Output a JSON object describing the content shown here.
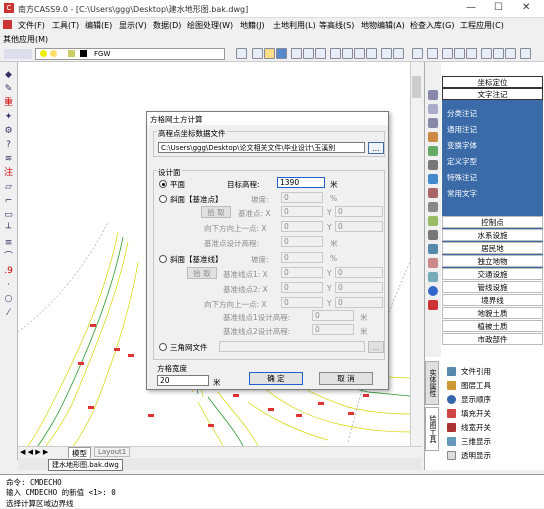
{
  "window": {
    "title": "南方CASS9.0 - [C:\\Users\\ggg\\Desktop\\建水地形图.bak.dwg]"
  },
  "menu": [
    "文件(F)",
    "工具(T)",
    "编辑(E)",
    "显示(V)",
    "数据(D)",
    "绘图处理(W)",
    "地籍(J)",
    "土地利用(L)",
    "等高线(S)",
    "地物编辑(A)",
    "检查入库(G)",
    "工程应用(C)"
  ],
  "menu2": "其他应用(M)",
  "layer": "FGW",
  "right_panel": {
    "top": [
      "坐标定位",
      "文字注记"
    ],
    "highlighted": [
      "分类注记",
      "通用注记",
      "变换字体",
      "定义字型",
      "特殊注记",
      "常用文字"
    ],
    "items": [
      "控制点",
      "水系设施",
      "居民地",
      "独立地物",
      "交通设施",
      "管线设施",
      "境界线",
      "地貌土质",
      "植被土质",
      "市政部件"
    ]
  },
  "right_bottom": {
    "tabs": [
      "实体属性",
      "绘图工具"
    ],
    "items": [
      "文件引用",
      "图层工具",
      "显示顺序",
      "填充开关",
      "线宽开关",
      "三维显示",
      "透明显示"
    ]
  },
  "tabs": {
    "model": "模型",
    "layout": "Layout1",
    "file": "建水地形图.bak.dwg"
  },
  "command": [
    "命令: CMDECHO",
    "输入 CMDECHO 的新值 <1>: 0",
    "选择计算区域边界线"
  ],
  "dialog": {
    "title": "方格网土方计算",
    "group1": "高程点坐标数据文件",
    "file_path": "C:\\Users\\ggg\\Desktop\\论文相关文件\\毕业设计\\玉溪别",
    "browse": "...",
    "design_group": "设计面",
    "flat_label": "平面",
    "target_elev_label": "目标高程:",
    "target_elev": "1390",
    "unit_m": "米",
    "slope1_label": "斜面【基准点】",
    "slope_label": "坡度:",
    "slope_val": "0",
    "pct": "%",
    "pick": "拾 取",
    "base_point": "基准点: X",
    "downdir": "向下方向上一点: X",
    "base_design": "基准点设计高程:",
    "zero": "0",
    "ylabel": "Y",
    "slope2_label": "斜面【基准线】",
    "line1": "基准线点1: X",
    "line2": "基准线点2: X",
    "downdir2": "向下方向上一点: X",
    "line1d": "基准线点1设计高程:",
    "line2d": "基准线点2设计高程:",
    "tin_label": "三角网文件",
    "grid_group": "方格宽度",
    "grid_width": "20",
    "ok": "确 定",
    "cancel": "取 消"
  }
}
